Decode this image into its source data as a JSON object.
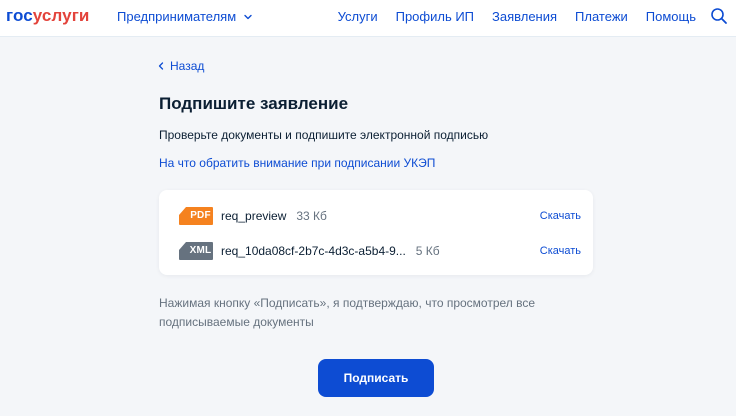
{
  "header": {
    "logo_part1": "гос",
    "logo_part2": "услуги",
    "entrepreneurs_label": "Предпринимателям",
    "nav": [
      "Услуги",
      "Профиль ИП",
      "Заявления",
      "Платежи",
      "Помощь"
    ],
    "search_icon": "search-icon"
  },
  "main": {
    "back_label": "Назад",
    "title": "Подпишите заявление",
    "subtitle": "Проверьте документы и подпишите электронной подписью",
    "help_link": "На что обратить внимание при подписании УКЭП",
    "documents": [
      {
        "type": "PDF",
        "name": "req_preview",
        "size": "33 Кб",
        "download": "Скачать",
        "badge_color": "#f5821f"
      },
      {
        "type": "XML",
        "name": "req_10da08cf-2b7c-4d3c-a5b4-9...",
        "size": "5 Кб",
        "download": "Скачать",
        "badge_color": "#66727f"
      }
    ],
    "notice": "Нажимая кнопку «Подписать», я подтверждаю, что просмотрел все подписываемые документы",
    "sign_button": "Подписать"
  },
  "colors": {
    "brand_blue": "#0d4cd3",
    "brand_red": "#e3433b",
    "background": "#f4f6f9"
  }
}
